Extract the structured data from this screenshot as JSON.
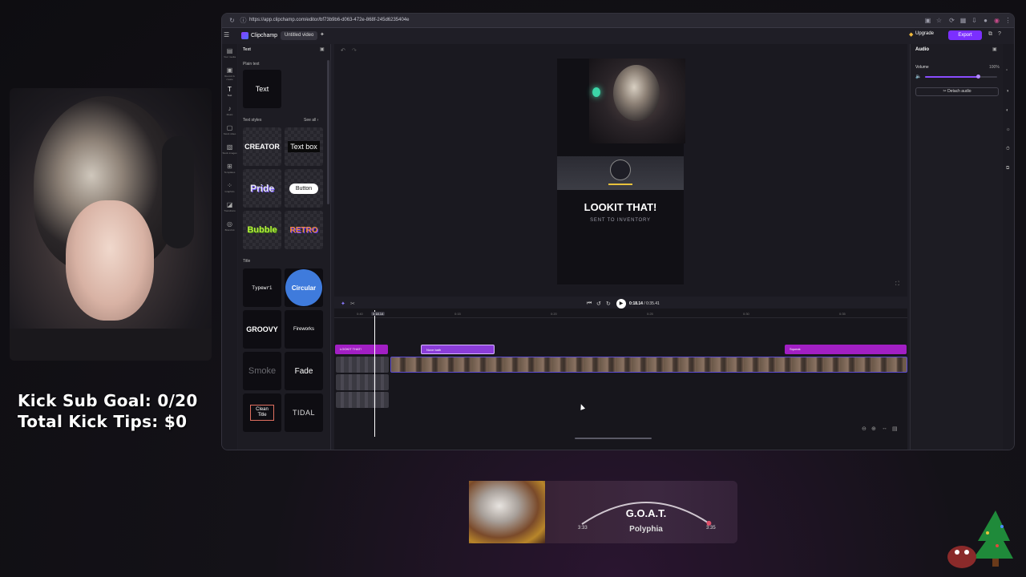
{
  "overlay": {
    "sub_goal": "Kick Sub Goal: 0/20",
    "tips": "Total Kick Tips: $0"
  },
  "browser": {
    "url": "https://app.clipchamp.com/editor/bf73b9b6-d063-472e-868f-245d6235404e"
  },
  "app": {
    "brand": "Clipchamp",
    "project_name": "Untitled video",
    "upgrade_label": "Upgrade",
    "export_label": "Export"
  },
  "rail": {
    "items": [
      {
        "icon": "▤",
        "label": "Your media"
      },
      {
        "icon": "▣",
        "label": "Record & create"
      },
      {
        "icon": "T",
        "label": "Text"
      },
      {
        "icon": "♪",
        "label": "Music"
      },
      {
        "icon": "▢",
        "label": "Stock video"
      },
      {
        "icon": "▧",
        "label": "Stock images"
      },
      {
        "icon": "⊞",
        "label": "Templates"
      },
      {
        "icon": "⁘",
        "label": "Graphics"
      },
      {
        "icon": "◪",
        "label": "Transitions"
      },
      {
        "icon": "◎",
        "label": "Brand kit"
      }
    ]
  },
  "panel": {
    "title": "Text",
    "plain_text_heading": "Plain text",
    "plain_text_tile": "Text",
    "text_styles_heading": "Text styles",
    "see_all": "See all",
    "styles": [
      "CREATOR",
      "Text box",
      "Pride",
      "Button",
      "Bubble",
      "RETRO"
    ],
    "title_heading": "Title",
    "titles": [
      "Typewri",
      "Circular",
      "GROOVY",
      "Fireworks",
      "Smoke",
      "Fade",
      "Clean Title",
      "TIDAL"
    ]
  },
  "preview": {
    "headline": "LOOKIT THAT!",
    "subline": "SENT TO INVENTORY"
  },
  "properties": {
    "tab": "Audio",
    "volume_label": "Volume",
    "volume_value": "100%",
    "volume_level": 0.73,
    "detach_label": "Detach audio"
  },
  "playback": {
    "current": "0:18.14",
    "total": "0:35.41"
  },
  "timeline": {
    "playhead_label": "0:18.14",
    "ruler_ticks": [
      "0:15",
      "0:20",
      "0:25",
      "0:30",
      "0:35",
      "0:40"
    ],
    "clips": [
      "LOOKIT THAT!",
      "Nove bath",
      "Squeak"
    ]
  },
  "now_playing": {
    "title": "G.O.A.T.",
    "artist": "Polyphia",
    "current": "3:33",
    "total": "3:35",
    "progress": 0.99
  },
  "colors": {
    "accent": "#7b2fff",
    "text_clip": "#a21fc4",
    "app_bg": "#1f1e26"
  }
}
